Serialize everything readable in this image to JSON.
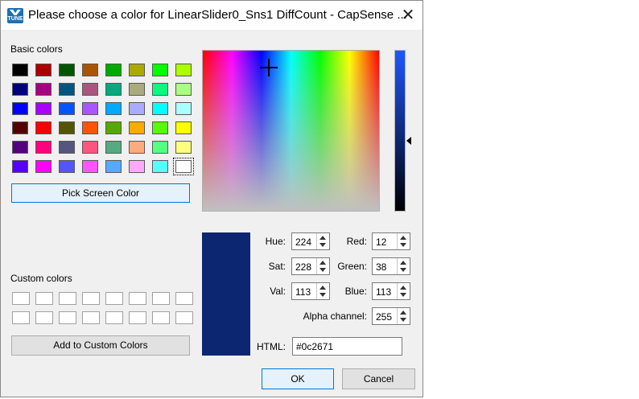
{
  "window": {
    "title": "Please choose a color for LinearSlider0_Sns1 DiffCount - CapSense ...",
    "close_glyph": "✕",
    "app_icon_text": "TUNE"
  },
  "basic_colors": {
    "label": "Basic colors",
    "rows": [
      [
        "#000000",
        "#aa0000",
        "#005500",
        "#aa5500",
        "#00aa00",
        "#aaaa00",
        "#00ff00",
        "#aaff00"
      ],
      [
        "#00007f",
        "#aa007f",
        "#00557f",
        "#aa557f",
        "#00aa7f",
        "#aaaa7f",
        "#00ff7f",
        "#aaff7f"
      ],
      [
        "#0000ff",
        "#aa00ff",
        "#0055ff",
        "#aa55ff",
        "#00aaff",
        "#aaaaff",
        "#00ffff",
        "#aaffff"
      ],
      [
        "#550000",
        "#ff0000",
        "#555500",
        "#ff5500",
        "#55aa00",
        "#ffaa00",
        "#55ff00",
        "#ffff00"
      ],
      [
        "#55007f",
        "#ff007f",
        "#55557f",
        "#ff557f",
        "#55aa7f",
        "#ffaa7f",
        "#55ff7f",
        "#ffff7f"
      ],
      [
        "#5500ff",
        "#ff00ff",
        "#5555ff",
        "#ff55ff",
        "#55aaff",
        "#ffaaff",
        "#55ffff",
        "#ffffff"
      ]
    ],
    "selected": "#ffffff"
  },
  "pick_screen_color_label": "Pick Screen Color",
  "custom_colors": {
    "label": "Custom colors",
    "add_label": "Add to Custom Colors"
  },
  "fields": {
    "hue": {
      "label": "Hue:",
      "value": "224"
    },
    "sat": {
      "label": "Sat:",
      "value": "228"
    },
    "val": {
      "label": "Val:",
      "value": "113"
    },
    "red": {
      "label": "Red:",
      "value": "12"
    },
    "green": {
      "label": "Green:",
      "value": "38"
    },
    "blue": {
      "label": "Blue:",
      "value": "113"
    },
    "alpha": {
      "label": "Alpha channel:",
      "value": "255"
    },
    "html": {
      "label": "HTML:",
      "value": "#0c2671"
    }
  },
  "current_color": "#0c2671",
  "value_level": 0.44,
  "picker_cursor": {
    "hue": 224,
    "sat": 228
  },
  "buttons": {
    "ok": "OK",
    "cancel": "Cancel"
  }
}
